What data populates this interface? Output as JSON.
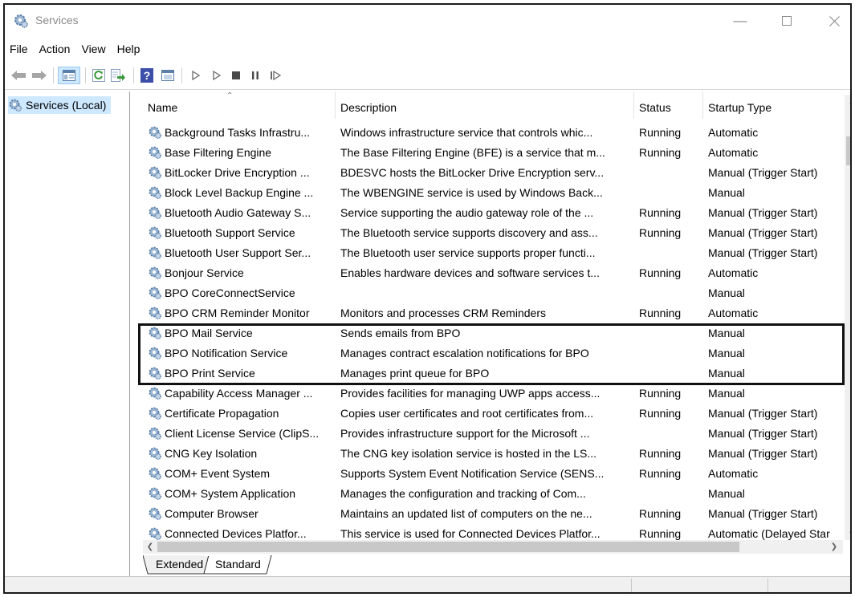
{
  "window": {
    "title": "Services"
  },
  "menu": [
    "File",
    "Action",
    "View",
    "Help"
  ],
  "toolbar": {
    "icons": [
      "back-arrow-icon",
      "forward-arrow-icon",
      "show-tree-icon",
      "refresh-icon",
      "export-list-icon",
      "help-icon",
      "properties-icon",
      "start-service-icon",
      "start-service-alt-icon",
      "stop-service-icon",
      "pause-service-icon",
      "resume-service-icon"
    ]
  },
  "tree": {
    "root_label": "Services (Local)"
  },
  "columns": [
    "Name",
    "Description",
    "Status",
    "Startup Type"
  ],
  "services": [
    {
      "name": "Background Tasks Infrastru...",
      "description": "Windows infrastructure service that controls whic...",
      "status": "Running",
      "startup": "Automatic"
    },
    {
      "name": "Base Filtering Engine",
      "description": "The Base Filtering Engine (BFE) is a service that m...",
      "status": "Running",
      "startup": "Automatic"
    },
    {
      "name": "BitLocker Drive Encryption ...",
      "description": "BDESVC hosts the BitLocker Drive Encryption serv...",
      "status": "",
      "startup": "Manual (Trigger Start)"
    },
    {
      "name": "Block Level Backup Engine ...",
      "description": "The WBENGINE service is used by Windows Back...",
      "status": "",
      "startup": "Manual"
    },
    {
      "name": "Bluetooth Audio Gateway S...",
      "description": "Service supporting the audio gateway role of the ...",
      "status": "Running",
      "startup": "Manual (Trigger Start)"
    },
    {
      "name": "Bluetooth Support Service",
      "description": "The Bluetooth service supports discovery and ass...",
      "status": "Running",
      "startup": "Manual (Trigger Start)"
    },
    {
      "name": "Bluetooth User Support Ser...",
      "description": "The Bluetooth user service supports proper functi...",
      "status": "",
      "startup": "Manual (Trigger Start)"
    },
    {
      "name": "Bonjour Service",
      "description": "Enables hardware devices and software services t...",
      "status": "Running",
      "startup": "Automatic"
    },
    {
      "name": "BPO CoreConnectService",
      "description": "",
      "status": "",
      "startup": "Manual"
    },
    {
      "name": "BPO CRM Reminder Monitor",
      "description": "Monitors and processes CRM Reminders",
      "status": "Running",
      "startup": "Automatic"
    },
    {
      "name": "BPO Mail Service",
      "description": "Sends emails from BPO",
      "status": "",
      "startup": "Manual"
    },
    {
      "name": "BPO Notification Service",
      "description": "Manages contract escalation notifications for BPO",
      "status": "",
      "startup": "Manual"
    },
    {
      "name": "BPO Print Service",
      "description": "Manages print queue for BPO",
      "status": "",
      "startup": "Manual"
    },
    {
      "name": "Capability Access Manager ...",
      "description": "Provides facilities for managing UWP apps access...",
      "status": "Running",
      "startup": "Manual"
    },
    {
      "name": "Certificate Propagation",
      "description": "Copies user certificates and root certificates from...",
      "status": "Running",
      "startup": "Manual (Trigger Start)"
    },
    {
      "name": "Client License Service (ClipS...",
      "description": "Provides infrastructure support for the Microsoft ...",
      "status": "",
      "startup": "Manual (Trigger Start)"
    },
    {
      "name": "CNG Key Isolation",
      "description": "The CNG key isolation service is hosted in the LS...",
      "status": "Running",
      "startup": "Manual (Trigger Start)"
    },
    {
      "name": "COM+ Event System",
      "description": "Supports System Event Notification Service (SENS...",
      "status": "Running",
      "startup": "Automatic"
    },
    {
      "name": "COM+ System Application",
      "description": "Manages the configuration and tracking of Com...",
      "status": "",
      "startup": "Manual"
    },
    {
      "name": "Computer Browser",
      "description": "Maintains an updated list of computers on the ne...",
      "status": "Running",
      "startup": "Manual (Trigger Start)"
    },
    {
      "name": "Connected Devices Platfor...",
      "description": "This service is used for Connected Devices Platfor...",
      "status": "Running",
      "startup": "Automatic (Delayed Star"
    }
  ],
  "tabs": [
    "Extended",
    "Standard"
  ],
  "active_tab": "Standard",
  "colors": {
    "selection": "#cde8ff",
    "highlight_border": "#111111",
    "gear": "#5a7fa8"
  }
}
